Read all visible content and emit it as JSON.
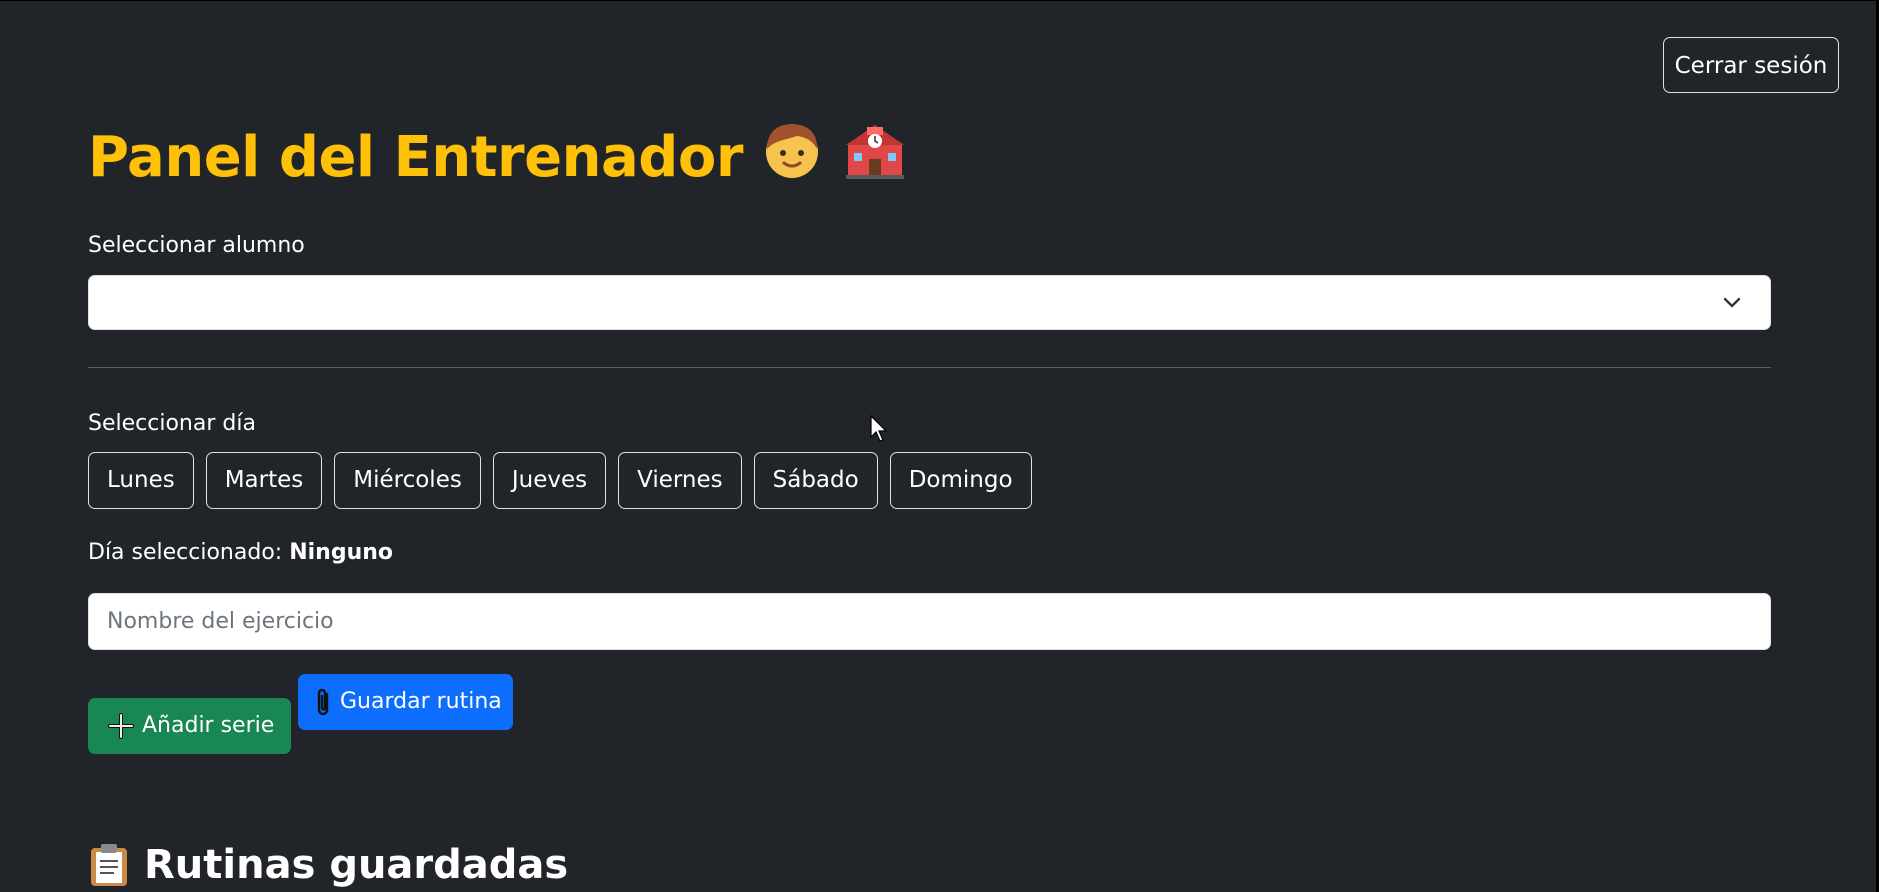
{
  "header": {
    "logout_label": "Cerrar sesión",
    "title": "Panel del Entrenador",
    "title_icons": [
      "boy-icon",
      "school-icon"
    ]
  },
  "student": {
    "label": "Seleccionar alumno",
    "selected_value": ""
  },
  "days": {
    "label": "Seleccionar día",
    "options": [
      "Lunes",
      "Martes",
      "Miércoles",
      "Jueves",
      "Viernes",
      "Sábado",
      "Domingo"
    ],
    "selected_prefix": "Día seleccionado:",
    "selected_value": "Ninguno"
  },
  "exercise": {
    "placeholder": "Nombre del ejercicio",
    "value": ""
  },
  "actions": {
    "add_series_label": "Añadir serie",
    "save_routine_label": "Guardar rutina"
  },
  "saved": {
    "title": "Rutinas guardadas",
    "icon": "clipboard-icon"
  },
  "colors": {
    "background": "#212529",
    "title": "#ffc107",
    "success": "#198754",
    "primary": "#0d6efd"
  }
}
